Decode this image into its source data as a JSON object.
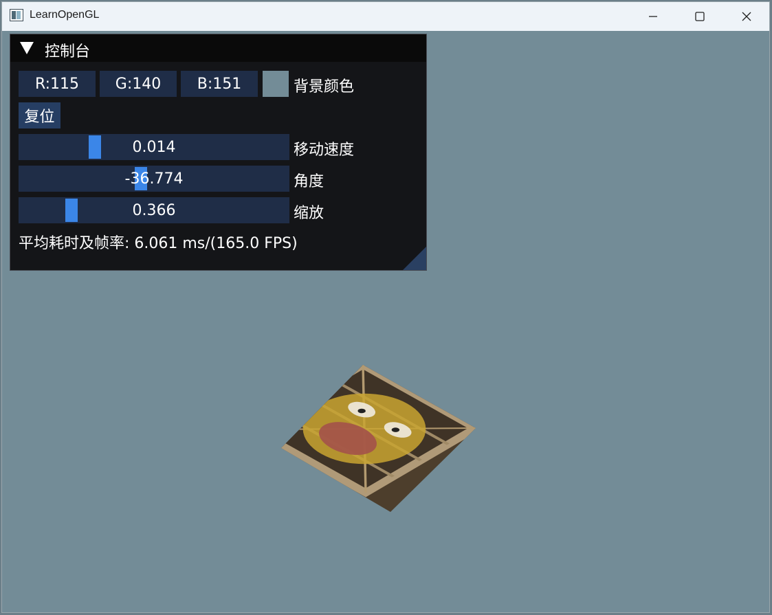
{
  "window": {
    "title": "LearnOpenGL"
  },
  "titlebar": {
    "icons": [
      "app-icon",
      "minimize-icon",
      "maximize-icon",
      "close-icon"
    ]
  },
  "panel": {
    "title": "控制台",
    "color": {
      "r": "R:115",
      "g": "G:140",
      "b": "B:151",
      "label": "背景颜色",
      "swatch_hex": "#738c97"
    },
    "reset_label": "复位",
    "sliders": [
      {
        "value": "0.014",
        "label": "移动速度",
        "fraction": 0.27
      },
      {
        "value": "-36.774",
        "label": "角度",
        "fraction": 0.45
      },
      {
        "value": "0.366",
        "label": "缩放",
        "fraction": 0.18
      }
    ],
    "perf": "平均耗时及帧率: 6.061 ms/(165.0 FPS)"
  },
  "colors": {
    "background": "#738c97",
    "panel": "#141518",
    "field": "#1f2d47",
    "accent": "#3b86e8"
  }
}
